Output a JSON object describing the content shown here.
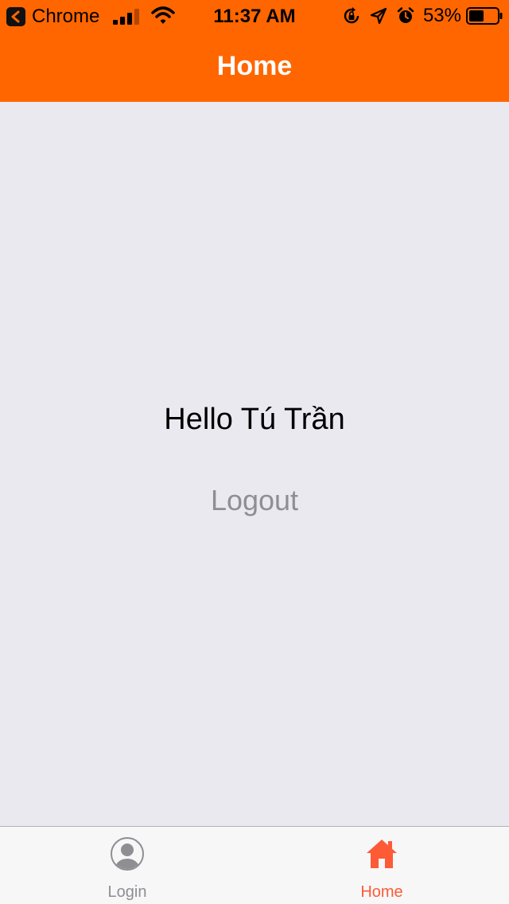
{
  "status_bar": {
    "back_app_label": "Chrome",
    "time": "11:37 AM",
    "battery_percent": "53%",
    "battery_level": 0.53
  },
  "nav": {
    "title": "Home"
  },
  "content": {
    "greeting": "Hello Tú Trần",
    "logout_label": "Logout"
  },
  "tabs": [
    {
      "label": "Login",
      "icon": "user-icon",
      "active": false
    },
    {
      "label": "Home",
      "icon": "home-icon",
      "active": true
    }
  ],
  "colors": {
    "header_bg": "#FF6600",
    "content_bg": "#EAE9EF",
    "tab_active": "#FF5A36",
    "tab_inactive": "#8E8E93",
    "logout_text": "#8E8E93"
  }
}
